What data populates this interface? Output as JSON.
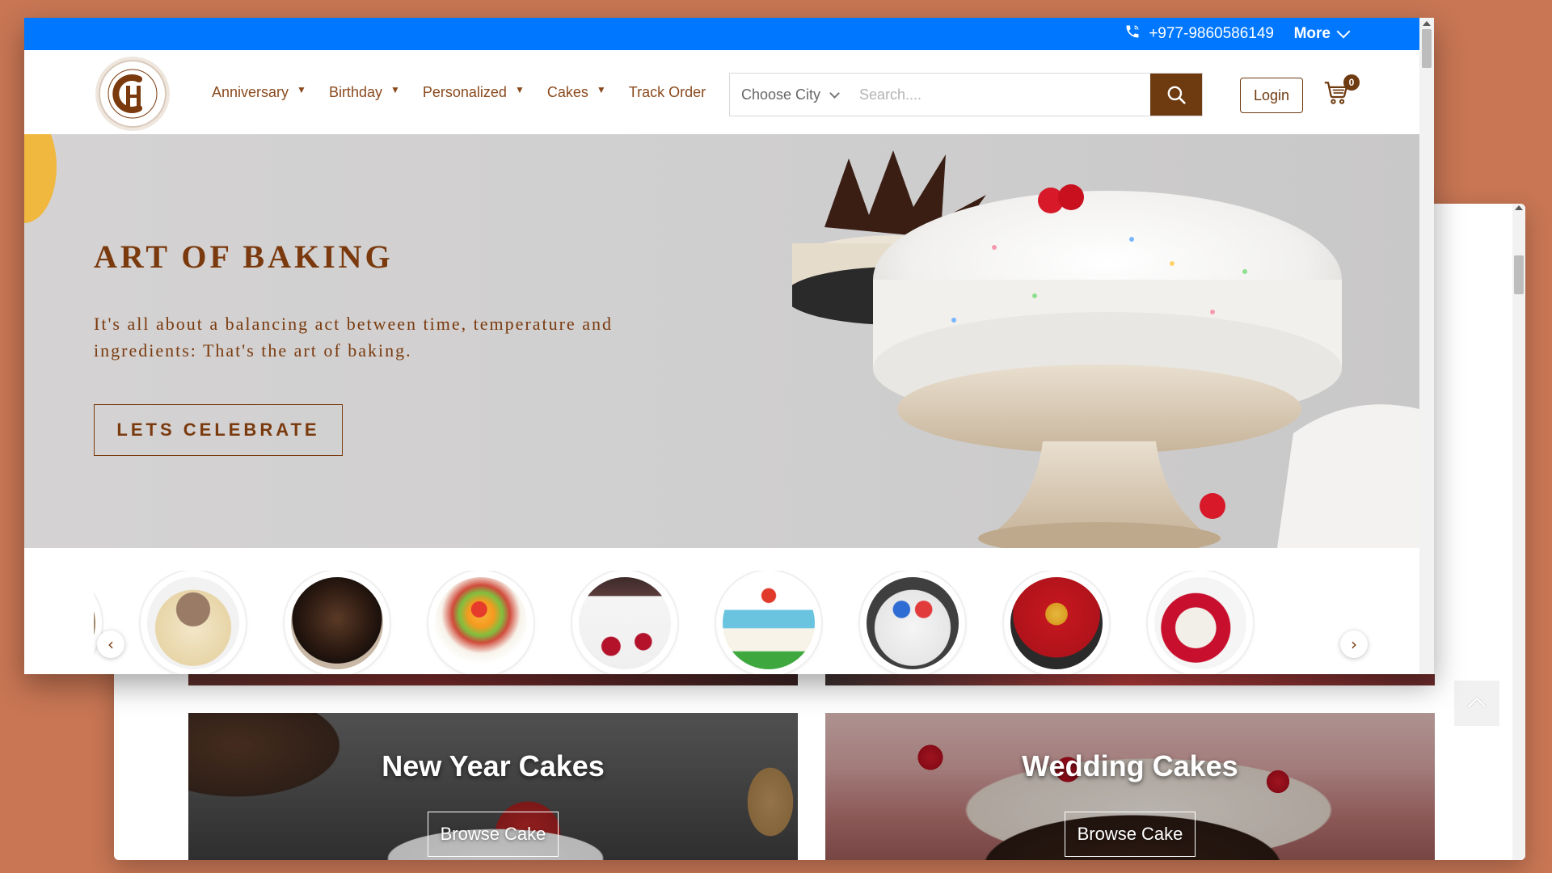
{
  "topbar": {
    "phone": "+977-9860586149",
    "more_label": "More",
    "icons": {
      "phone": "phone-icon",
      "more": "chevron-down-icon"
    }
  },
  "nav": {
    "logo_alt": "Cake House logo",
    "menu": [
      {
        "label": "Anniversary",
        "has_caret": true
      },
      {
        "label": "Birthday",
        "has_caret": true
      },
      {
        "label": "Personalized",
        "has_caret": true
      },
      {
        "label": "Cakes",
        "has_caret": true
      },
      {
        "label": "Track Order",
        "has_caret": false
      }
    ],
    "search": {
      "city_label": "Choose City",
      "placeholder": "Search...."
    },
    "login_label": "Login",
    "cart_count": "0"
  },
  "hero": {
    "title": "ART OF BAKING",
    "subtitle": "It's all about a balancing act between time, temperature and ingredients: That's the art of baking.",
    "cta_label": "LETS CELEBRATE"
  },
  "carousel": {
    "items": [
      "Heart photo cake",
      "Chocolate truffle cake",
      "Fresh fruit cake",
      "Two-tier floral cake",
      "Mario theme cake",
      "Sneakers theme cake",
      "Chocolate bouquet cake",
      "Heart handle photo mug",
      "Rose bouquet"
    ]
  },
  "promos": {
    "newyear": {
      "title": "New Year Cakes",
      "button": "Browse Cake"
    },
    "wedding": {
      "title": "Wedding Cakes",
      "button": "Browse Cake"
    }
  },
  "colors": {
    "brand_brown": "#6e3a0f",
    "topbar_blue": "#0077ff",
    "hero_bg": "#d0cfcf",
    "page_bg": "#c87654"
  }
}
